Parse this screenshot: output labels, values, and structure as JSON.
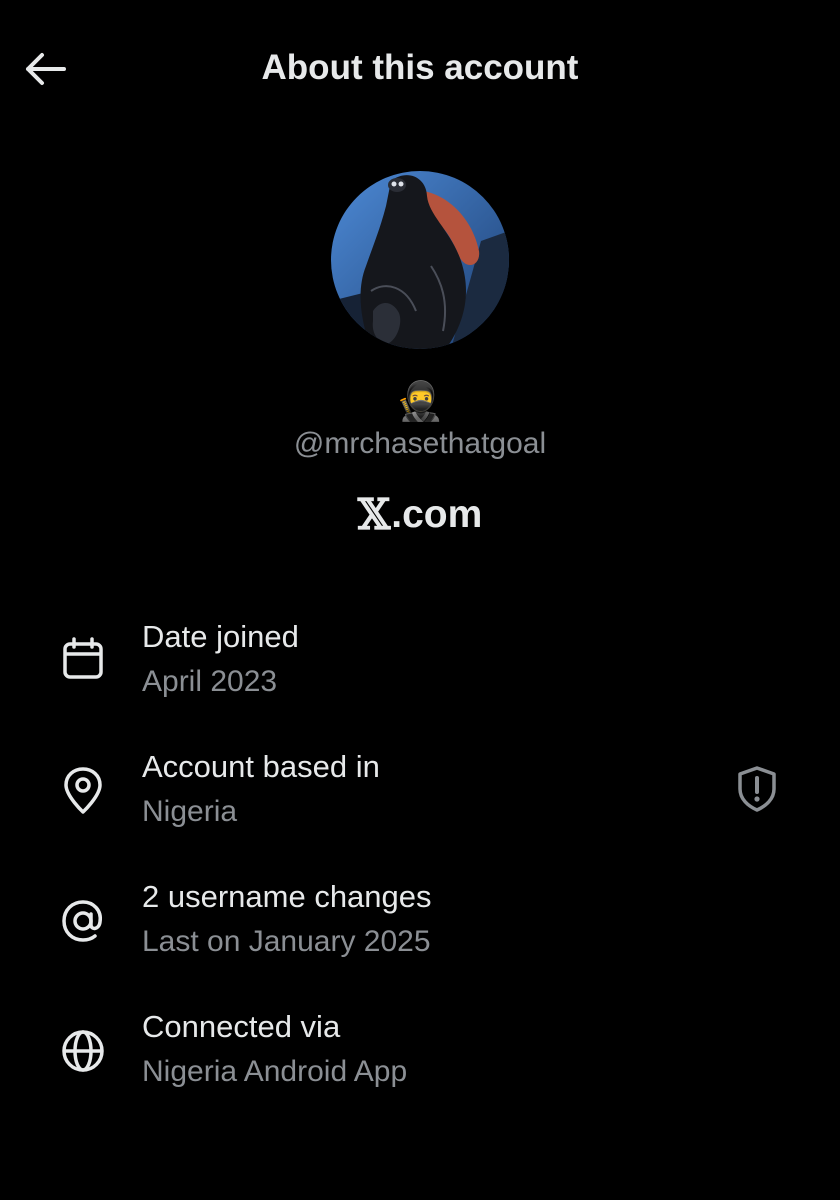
{
  "header": {
    "title": "About this account",
    "back_icon": "arrow-left-icon"
  },
  "profile": {
    "display_name": "🥷",
    "handle": "@mrchasethatgoal",
    "avatar_icon": "profile-avatar-image"
  },
  "brand": {
    "x_glyph": "𝕏",
    "suffix": ".com"
  },
  "info": {
    "date_joined": {
      "icon": "calendar-icon",
      "label": "Date joined",
      "value": "April 2023"
    },
    "account_based": {
      "icon": "location-pin-icon",
      "label": "Account based in",
      "value": "Nigeria",
      "action_icon": "shield-alert-icon"
    },
    "username_changes": {
      "icon": "at-sign-icon",
      "label": "2 username changes",
      "value": "Last on January 2025"
    },
    "connected_via": {
      "icon": "globe-icon",
      "label": "Connected via",
      "value": "Nigeria Android App"
    }
  },
  "colors": {
    "background": "#000000",
    "primary_text": "#e7e9ea",
    "secondary_text": "#8b8f94",
    "avatar_sky": "#3a70b8"
  }
}
